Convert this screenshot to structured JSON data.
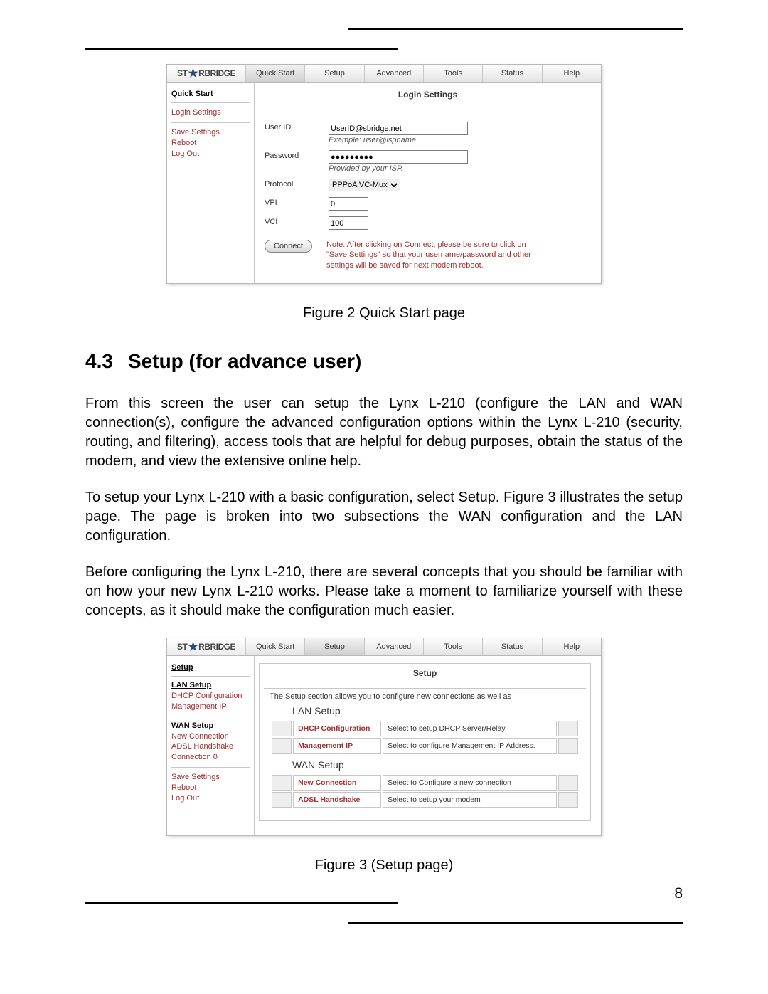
{
  "pageNumber": "8",
  "figure2": {
    "caption": "Figure 2 Quick Start page",
    "logo": "ST★RBRIDGE",
    "tabs": [
      "Quick Start",
      "Setup",
      "Advanced",
      "Tools",
      "Status",
      "Help"
    ],
    "sidebar": {
      "title": "Quick Start",
      "links1": [
        "Login Settings"
      ],
      "links2": [
        "Save Settings",
        "Reboot",
        "Log Out"
      ]
    },
    "mainTitle": "Login Settings",
    "form": {
      "userIdLabel": "User ID",
      "userIdValue": "UserID@sbridge.net",
      "userIdHint": "Example: user@ispname",
      "passwordLabel": "Password",
      "passwordValue": "●●●●●●●●●",
      "passwordHint": "Provided by your ISP.",
      "protocolLabel": "Protocol",
      "protocolValue": "PPPoA VC-Mux",
      "vpiLabel": "VPI",
      "vpiValue": "0",
      "vciLabel": "VCI",
      "vciValue": "100",
      "connectLabel": "Connect",
      "note": "Note: After clicking on Connect, please be sure to click on \"Save Settings\" so that your username/password and other settings will be saved for next modem reboot."
    }
  },
  "section": {
    "number": "4.3",
    "title": "Setup (for advance user)",
    "p1": "From this screen the user can setup the Lynx L-210 (configure the LAN and WAN connection(s), configure the advanced configuration options within the Lynx L-210 (security, routing, and filtering), access tools that are helpful for debug purposes, obtain the status of the modem, and view the extensive online help.",
    "p2": "To setup your Lynx L-210 with a basic configuration, select Setup.  Figure 3 illustrates the setup page.  The page is broken into two subsections the WAN configuration and the LAN configuration.",
    "p3": "Before configuring the Lynx L-210, there are several concepts that you should be familiar with on how your new Lynx L-210 works. Please take a moment to familiarize yourself with these concepts, as it should make the configuration much easier."
  },
  "figure3": {
    "caption": "Figure 3 (Setup page)",
    "logo": "ST★RBRIDGE",
    "tabs": [
      "Quick Start",
      "Setup",
      "Advanced",
      "Tools",
      "Status",
      "Help"
    ],
    "sidebar": {
      "title": "Setup",
      "lanHeader": "LAN Setup",
      "lanLinks": [
        "DHCP Configuration",
        "Management IP"
      ],
      "wanHeader": "WAN Setup",
      "wanLinks": [
        "New Connection",
        "ADSL Handshake",
        "Connection 0"
      ],
      "footerLinks": [
        "Save Settings",
        "Reboot",
        "Log Out"
      ]
    },
    "main": {
      "title": "Setup",
      "intro": "The Setup section allows you to configure new connections as well as",
      "lanTitle": "LAN Setup",
      "lanRows": [
        {
          "label": "DHCP Configuration",
          "desc": "Select to setup DHCP Server/Relay."
        },
        {
          "label": "Management IP",
          "desc": "Select to configure Management IP Address."
        }
      ],
      "wanTitle": "WAN Setup",
      "wanRows": [
        {
          "label": "New Connection",
          "desc": "Select to Configure a new connection"
        },
        {
          "label": "ADSL Handshake",
          "desc": "Select to setup your modem"
        }
      ]
    }
  }
}
